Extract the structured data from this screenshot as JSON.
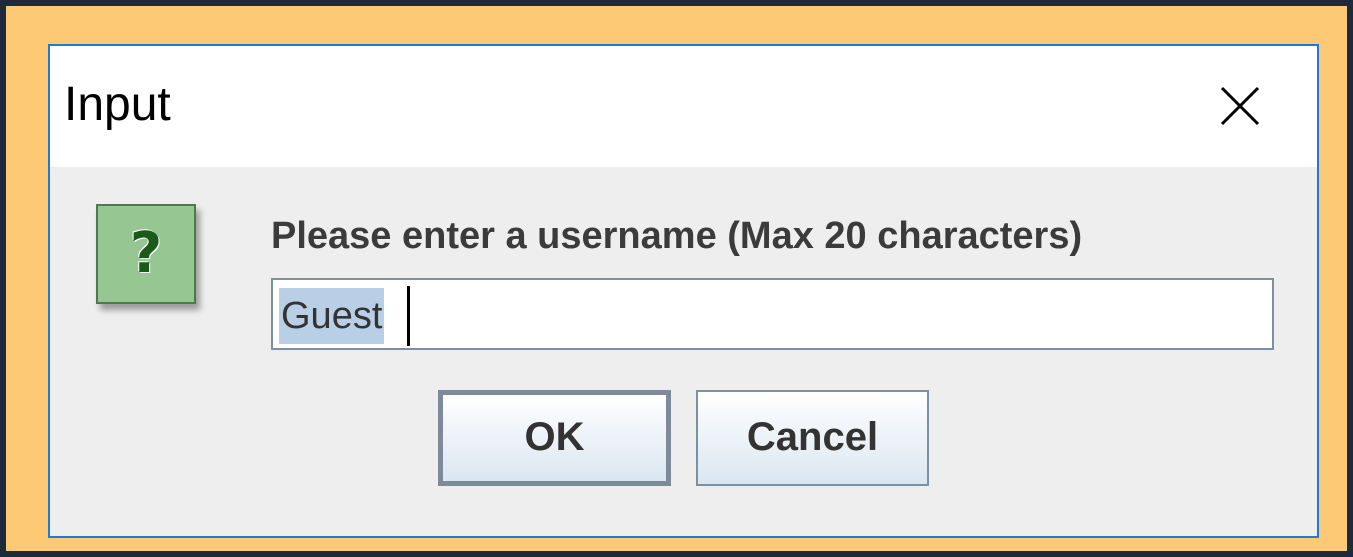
{
  "dialog": {
    "title": "Input",
    "close_icon": "close-icon",
    "message_icon": "question-icon",
    "message_icon_glyph": "?",
    "prompt": "Please enter a username (Max 20 characters)",
    "input": {
      "value": "Guest",
      "selected": true
    },
    "buttons": {
      "ok_label": "OK",
      "cancel_label": "Cancel"
    }
  },
  "colors": {
    "outer_background": "#1c2a3a",
    "frame": "#fdc974",
    "dialog_border": "#1f7ad6",
    "dialog_body": "#eeeeee",
    "icon_fill": "#96c691",
    "selection": "#b8cfe5"
  }
}
